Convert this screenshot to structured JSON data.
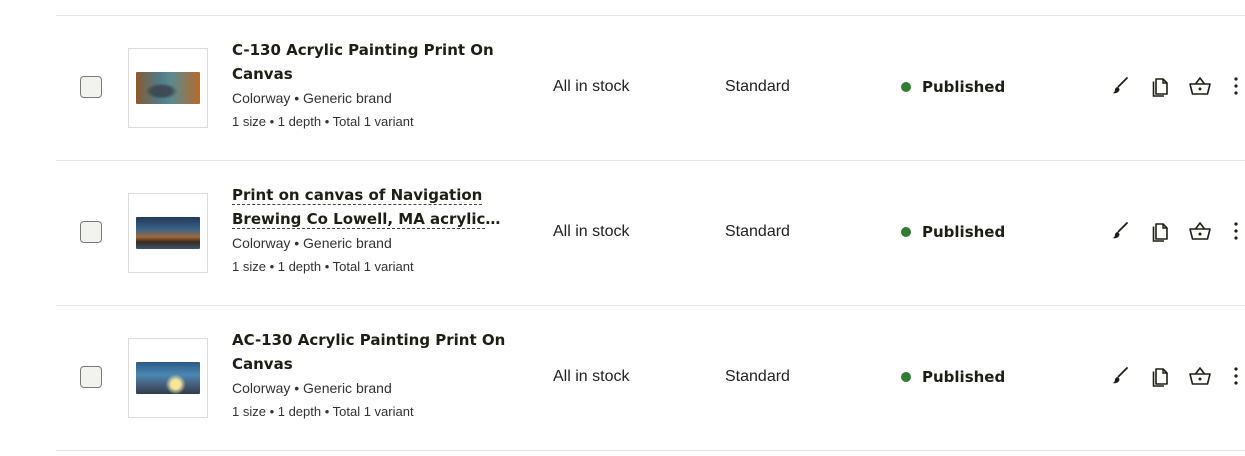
{
  "products": [
    {
      "title": "C-130 Acrylic Painting Print On Canvas",
      "title_is_link": false,
      "brand_line": "Colorway • Generic brand",
      "variant_line": "1 size • 1 depth • Total 1 variant",
      "stock": "All in stock",
      "type": "Standard",
      "status": "Published"
    },
    {
      "title": "Print on canvas of Navigation Brewing Co Lowell, MA acrylic paint…",
      "title_is_link": true,
      "brand_line": "Colorway • Generic brand",
      "variant_line": "1 size • 1 depth • Total 1 variant",
      "stock": "All in stock",
      "type": "Standard",
      "status": "Published"
    },
    {
      "title": "AC-130 Acrylic Painting Print On Canvas",
      "title_is_link": false,
      "brand_line": "Colorway • Generic brand",
      "variant_line": "1 size • 1 depth • Total 1 variant",
      "stock": "All in stock",
      "type": "Standard",
      "status": "Published"
    }
  ],
  "icons": {
    "edit": "brush-icon",
    "duplicate": "copy-icon",
    "shop": "basket-icon",
    "more": "more-vertical-icon"
  },
  "colors": {
    "status_published": "#2e7d32",
    "text": "#1e1e14",
    "divider": "#e6e6e6"
  }
}
